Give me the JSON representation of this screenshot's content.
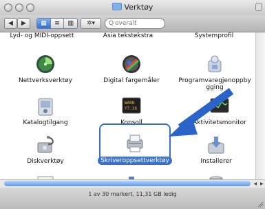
{
  "window": {
    "title": "Verktøy"
  },
  "toolbar": {
    "back_icon": "◀",
    "forward_icon": "▶",
    "view_icons": "▦",
    "view_list": "≡",
    "view_columns": "▥",
    "action_icon": "✲▾",
    "search_placeholder": "overalt"
  },
  "top_row": [
    "Lyd- og MIDI-oppsett",
    "Asia tekstekstra",
    "Systemprofil"
  ],
  "items": {
    "nettverksverktoy": "Nettverksverktøy",
    "fargemaler": "Digital fargemåler",
    "programvare": "Programvaregjenoppbygging",
    "katalogtilgang": "Katalogtilgang",
    "konsoll": "Konsoll",
    "aktivitetsmonitor": "Aktivitetsmonitor",
    "diskverktoy": "Diskverktøy",
    "skriveroppsett": "Skriveroppsettverktøy",
    "installerer": "Installerer"
  },
  "statusbar": {
    "text": "1 av 30 markert, 11,31 GB ledig"
  },
  "colors": {
    "selection": "#3b74d6",
    "arrow": "#2b64c8"
  }
}
